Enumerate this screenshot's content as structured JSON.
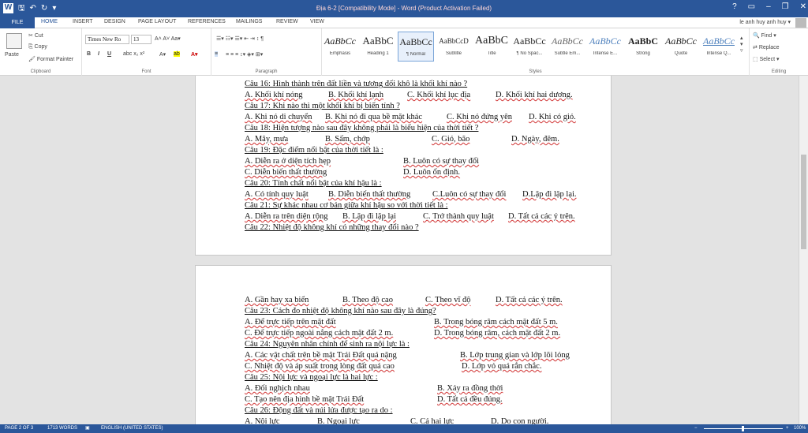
{
  "titlebar": {
    "title": "Địa 6-2 [Compatibility Mode] - Word (Product Activation Failed)",
    "logo": "W",
    "help": "?",
    "restore": "▭",
    "minimize": "–",
    "maximize": "❐",
    "close": "✕"
  },
  "tabs": {
    "file": "FILE",
    "home": "HOME",
    "insert": "INSERT",
    "design": "DESIGN",
    "page_layout": "PAGE LAYOUT",
    "references": "REFERENCES",
    "mailings": "MAILINGS",
    "review": "REVIEW",
    "view": "VIEW",
    "user": "le anh huy anh huy ▾"
  },
  "ribbon": {
    "clipboard": {
      "paste": "Paste",
      "cut": "Cut",
      "copy": "Copy",
      "format_painter": "Format Painter",
      "label": "Clipboard"
    },
    "font": {
      "name": "Times New Ro",
      "size": "13",
      "label": "Font"
    },
    "paragraph": {
      "label": "Paragraph"
    },
    "styles": {
      "label": "Styles",
      "items": [
        {
          "preview": "AaBbCc",
          "name": "Emphasis"
        },
        {
          "preview": "AaBbC",
          "name": "Heading 1"
        },
        {
          "preview": "AaBbCc",
          "name": "¶ Normal"
        },
        {
          "preview": "AaBbCcD",
          "name": "Subtitle"
        },
        {
          "preview": "AaBbC",
          "name": "Title"
        },
        {
          "preview": "AaBbCc",
          "name": "¶ No Spac..."
        },
        {
          "preview": "AaBbCc",
          "name": "Subtle Em..."
        },
        {
          "preview": "AaBbCc",
          "name": "Intense E..."
        },
        {
          "preview": "AaBbC",
          "name": "Strong"
        },
        {
          "preview": "AaBbCc",
          "name": "Quote"
        },
        {
          "preview": "AaBbCc",
          "name": "Intense Q..."
        }
      ]
    },
    "editing": {
      "find": "Find ▾",
      "replace": "Replace",
      "select": "Select ▾",
      "label": "Editing"
    }
  },
  "page1": {
    "lines": [
      {
        "cells": [
          "Câu 16: Hình thành trên đất liền và tương đối khô là khối khí nào ?"
        ]
      },
      {
        "cells": [
          "A. Khối khí nóng",
          "B. Khối khí lạnh",
          "C. Khối khí lục địa",
          "D. Khối khí hai dương."
        ]
      },
      {
        "cells": [
          "Câu 17: Khi nào thì một khối khí bị biến tính ?"
        ]
      },
      {
        "cells": [
          "A. Khi nó di chuyển",
          "B. Khi nó đi qua bề mặt khác",
          "C. Khi nó đứng yên",
          "D. Khi có gió."
        ]
      },
      {
        "cells": [
          "Câu 18: Hiện tượng nào sau đây không phải là biểu hiện của thời tiết ?"
        ]
      },
      {
        "cells": [
          "A. Mây, mưa",
          "B. Sấm, chớp",
          "C. Gió, bão",
          "D. Ngày, đêm."
        ]
      },
      {
        "cells": [
          "Câu 19: Đặc điểm nổi bật của thời tiết là :"
        ]
      },
      {
        "cells": [
          "A. Diễn ra ở diện tích hẹp",
          "B. Luôn có sự thay đổi"
        ]
      },
      {
        "cells": [
          "C. Diễn biến thất thường",
          "D. Luôn ổn định."
        ]
      },
      {
        "cells": [
          "Câu 20: Tính chất nổi bật của khí hậu là :"
        ]
      },
      {
        "cells": [
          "A. Có tính quy luật",
          "B. Diễn biến thất thường",
          "C.Luôn có sự thay đổi",
          "D.Lặp đi lặp lại."
        ]
      },
      {
        "cells": [
          "Câu 21: Sự khác nhau cơ bản giữa khí hậu so với thời tiết là :"
        ]
      },
      {
        "cells": [
          "A. Diễn ra trên diện rộng",
          "B. Lặp đi lặp lại",
          "C. Trở thành quy luật",
          "D. Tất cả các ý trên."
        ]
      },
      {
        "cells": [
          "Câu 22: Nhiệt độ không khí có những thay đổi nào ?"
        ]
      }
    ]
  },
  "page2": {
    "lines": [
      {
        "cells": [
          "A. Gần hay xa biển",
          "B. Theo độ cao",
          "C. Theo vĩ độ",
          "D. Tất cả các ý trên."
        ]
      },
      {
        "cells": [
          "Câu 23: Cách đo nhiệt độ không khí nào sau đây là đúng?"
        ]
      },
      {
        "cells": [
          "A. Để trực tiếp trên mặt đất",
          "B. Trong bóng râm cách mặt đất 5 m."
        ]
      },
      {
        "cells": [
          "C. Để trực tiếp ngoài nắng cách mặt đất 2 m.",
          "D. Trong bóng râm, cách mặt đất 2 m."
        ]
      },
      {
        "cells": [
          "Câu 24: Nguyên nhân chính để sinh ra nội lực là :"
        ]
      },
      {
        "cells": [
          "A. Các vật chất trên bề mặt Trái Đất quá nặng",
          "B. Lớp trung gian và lớp lõi lỏng"
        ]
      },
      {
        "cells": [
          "C. Nhiệt độ và áp suất trong lòng đất quá cao",
          "D. Lớp vỏ quá rắn chắc."
        ]
      },
      {
        "cells": [
          "Câu 25: Nội lực và ngoại lực là hai lực :"
        ]
      },
      {
        "cells": [
          "A. Đối nghịch nhau",
          "B. Xảy ra đồng thời"
        ]
      },
      {
        "cells": [
          "C. Tạo nên địa hình bề mặt Trái Đất",
          "D. Tất cả đều đúng."
        ]
      },
      {
        "cells": [
          "Câu 26: Động đất và núi lửa được tạo ra do :"
        ]
      },
      {
        "cells": [
          "A. Nội lực",
          "B. Ngoại lực",
          "C. Cả hai lực",
          "D. Do con người."
        ]
      }
    ]
  },
  "status": {
    "page": "PAGE 2 OF 3",
    "words": "1713 WORDS",
    "language": "ENGLISH (UNITED STATES)",
    "zoom": "100%"
  }
}
